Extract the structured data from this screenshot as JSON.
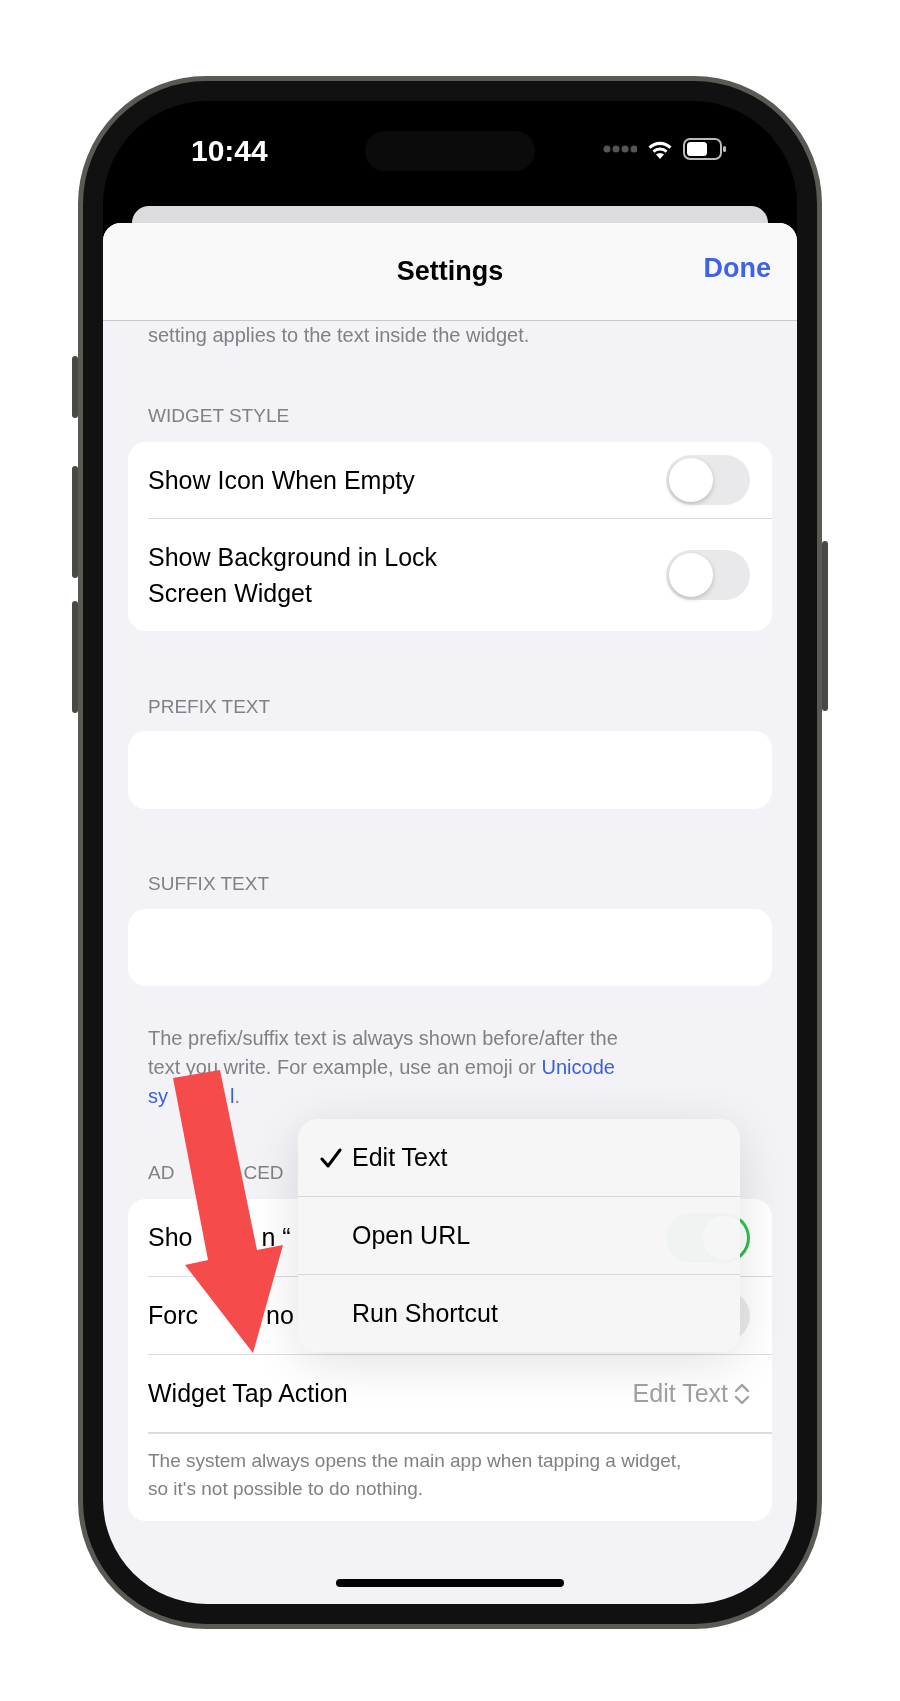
{
  "status_bar": {
    "time": "10:44"
  },
  "sheet": {
    "title": "Settings",
    "done": "Done"
  },
  "top_note": "setting applies to the text inside the widget.",
  "widget_style": {
    "header": "WIDGET STYLE",
    "rows": [
      {
        "label": "Show Icon When Empty",
        "on": false
      },
      {
        "label": "Show Background in Lock Screen Widget",
        "on": false
      }
    ]
  },
  "prefix": {
    "header": "PREFIX TEXT"
  },
  "suffix": {
    "header": "SUFFIX TEXT"
  },
  "affix_note": {
    "text": "The prefix/suffix text is always shown before/after the text you write. For example, use an emoji or",
    "link_parts": [
      "Unicode",
      "sy",
      "l"
    ],
    "end": "."
  },
  "advanced": {
    "header_parts": [
      "AD",
      "CED"
    ],
    "rows": [
      {
        "kind": "toggle",
        "label_parts": [
          "Sho",
          "n “"
        ],
        "on": true
      },
      {
        "kind": "toggle",
        "label_parts": [
          "Forc",
          "no"
        ],
        "on": false
      },
      {
        "kind": "picker",
        "label": "Widget Tap Action",
        "value": "Edit Text"
      }
    ],
    "footer": "The system always opens the main app when tapping a widget, so it's not possible to do nothing."
  },
  "menu": {
    "items": [
      {
        "label": "Edit Text",
        "selected": true
      },
      {
        "label": "Open URL",
        "selected": false
      },
      {
        "label": "Run Shortcut",
        "selected": false
      }
    ]
  }
}
